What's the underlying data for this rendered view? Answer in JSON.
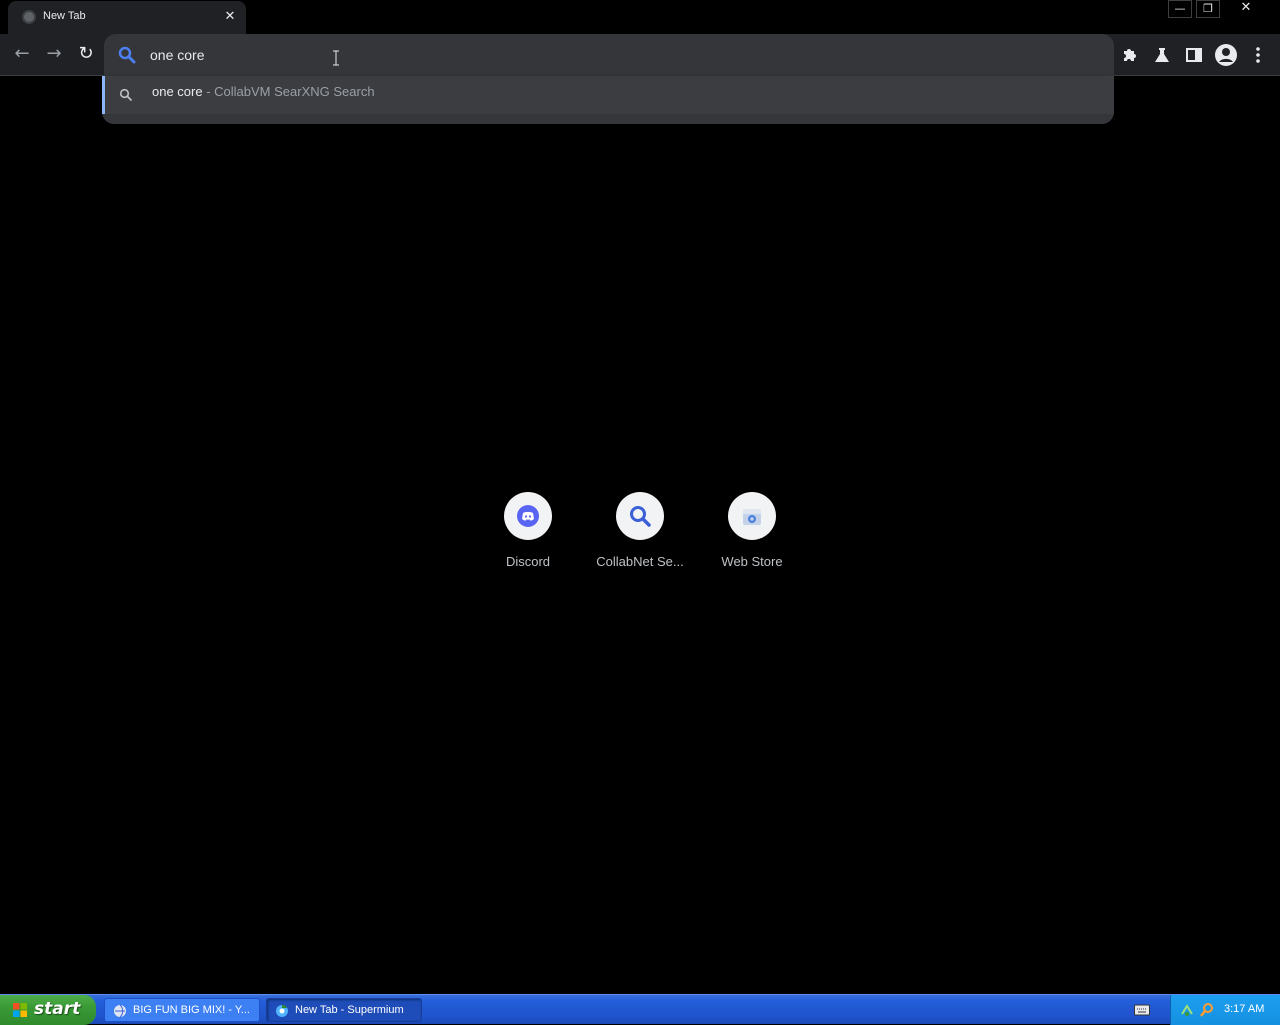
{
  "tab": {
    "title": "New Tab",
    "close_glyph": "✕",
    "favicon": "globe-icon"
  },
  "window_controls": {
    "minimize": "—",
    "restore": "❐",
    "close": "✕"
  },
  "toolbar": {
    "back_glyph": "←",
    "forward_glyph": "→",
    "reload_glyph": "↻",
    "omnibox_value": "one core",
    "icons": [
      "extensions-icon",
      "labs-icon",
      "side-panel-icon",
      "profile-icon",
      "menu-icon"
    ]
  },
  "dropdown": {
    "query": "one core",
    "separator": " - ",
    "engine": "CollabVM SearXNG Search"
  },
  "shortcuts": [
    {
      "label": "Discord",
      "icon": "discord-icon"
    },
    {
      "label": "CollabNet Se...",
      "icon": "search-icon"
    },
    {
      "label": "Web Store",
      "icon": "web-store-icon"
    }
  ],
  "taskbar": {
    "start_label": "start",
    "tasks": [
      {
        "label": "BIG FUN BIG MIX! - Y...",
        "state": "inactive"
      },
      {
        "label": "New Tab - Supermium",
        "state": "active"
      }
    ],
    "clock": "3:17 AM"
  },
  "colors": {
    "accent": "#8ab4f8",
    "omnibox_bg": "#35363a",
    "toolbar_bg": "#202124",
    "taskbar_blue": "#245edb",
    "start_green": "#3a9a36"
  }
}
